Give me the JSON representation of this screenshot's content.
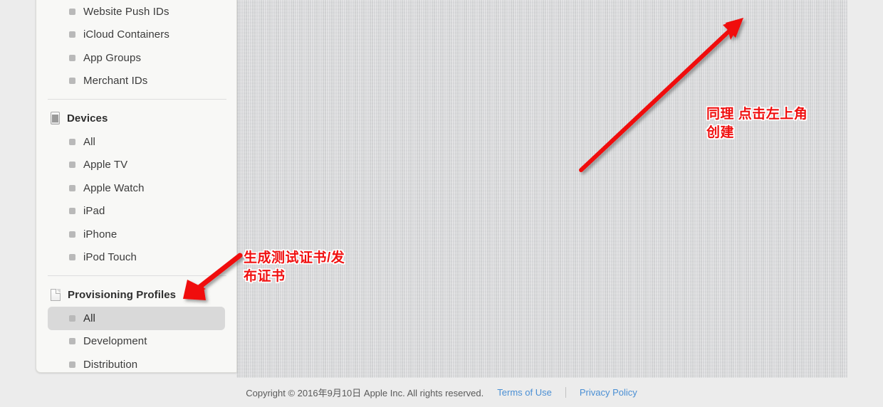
{
  "sidebar": {
    "top_items": [
      {
        "label": "Website Push IDs",
        "icon": "bullet-icon",
        "selected": false
      },
      {
        "label": "iCloud Containers",
        "icon": "bullet-icon",
        "selected": false
      },
      {
        "label": "App Groups",
        "icon": "bullet-icon",
        "selected": false
      },
      {
        "label": "Merchant IDs",
        "icon": "bullet-icon",
        "selected": false
      }
    ],
    "devices_group": {
      "title": "Devices",
      "icon": "device-icon",
      "items": [
        {
          "label": "All",
          "icon": "bullet-icon",
          "selected": false
        },
        {
          "label": "Apple TV",
          "icon": "bullet-icon",
          "selected": false
        },
        {
          "label": "Apple Watch",
          "icon": "bullet-icon",
          "selected": false
        },
        {
          "label": "iPad",
          "icon": "bullet-icon",
          "selected": false
        },
        {
          "label": "iPhone",
          "icon": "bullet-icon",
          "selected": false
        },
        {
          "label": "iPod Touch",
          "icon": "bullet-icon",
          "selected": false
        }
      ]
    },
    "profiles_group": {
      "title": "Provisioning Profiles",
      "icon": "document-icon",
      "items": [
        {
          "label": "All",
          "icon": "bullet-icon",
          "selected": true
        },
        {
          "label": "Development",
          "icon": "bullet-icon",
          "selected": false
        },
        {
          "label": "Distribution",
          "icon": "bullet-icon",
          "selected": false
        }
      ]
    }
  },
  "footer": {
    "copyright": "Copyright © 2016年9月10日 Apple Inc. All rights reserved.",
    "terms_label": "Terms of Use",
    "privacy_label": "Privacy Policy"
  },
  "annotations": {
    "top_right": "同理 点击左上角创建",
    "mid_left": "生成测试证书/发布证书",
    "color": "#f01010"
  },
  "colors": {
    "sidebar_bg": "#f8f8f6",
    "content_bg": "#d3d4d6",
    "footer_bg": "#ececec",
    "link": "#4a8fd4",
    "selected_row": "#d9d9d9",
    "annotation_red": "#f01010"
  }
}
